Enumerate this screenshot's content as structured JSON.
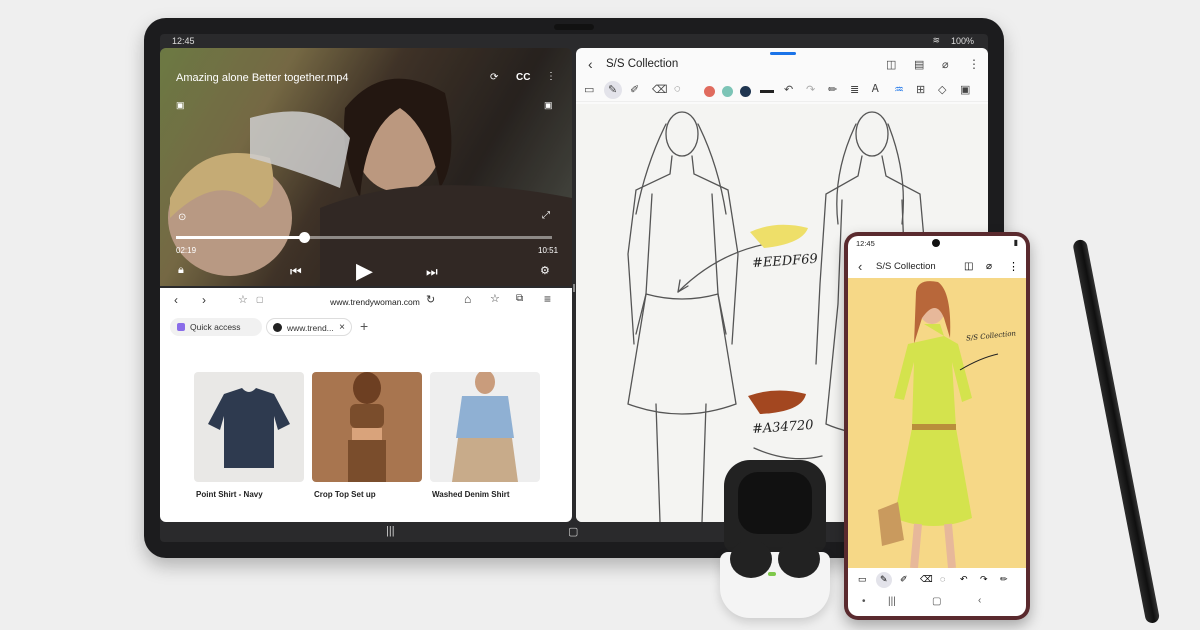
{
  "tablet": {
    "status": {
      "time": "12:45",
      "battery": "100%"
    },
    "video": {
      "title": "Amazing alone Better together.mp4",
      "cc_label": "CC",
      "elapsed": "02:19",
      "duration": "10:51",
      "progress": 0.34
    },
    "browser": {
      "url": "www.trendywoman.com",
      "tabs": [
        {
          "label": "Quick access"
        },
        {
          "label": "www.trend..."
        }
      ],
      "products": [
        {
          "name": "Point Shirt - Navy",
          "color": "#2e3a4f"
        },
        {
          "name": "Crop Top Set up",
          "color": "#8b5e3c"
        },
        {
          "name": "Washed Denim Shirt",
          "color": "#8fb0d3"
        }
      ]
    },
    "notes": {
      "title": "S/S Collection",
      "palette": [
        "#e06b5e",
        "#7cc4b6",
        "#1f3550",
        "#222222"
      ],
      "swatches": [
        {
          "code": "#EEDF69",
          "color": "#eedf69"
        },
        {
          "code": "#A34720",
          "color": "#a34720"
        }
      ]
    }
  },
  "phone": {
    "status": {
      "time": "12:45"
    },
    "title": "S/S Collection",
    "art_caption": "S/S Collection"
  },
  "colors": {
    "tablet_frame": "#1c1c1e",
    "phone_frame": "#5a2a2e",
    "accent": "#1a73e8"
  }
}
